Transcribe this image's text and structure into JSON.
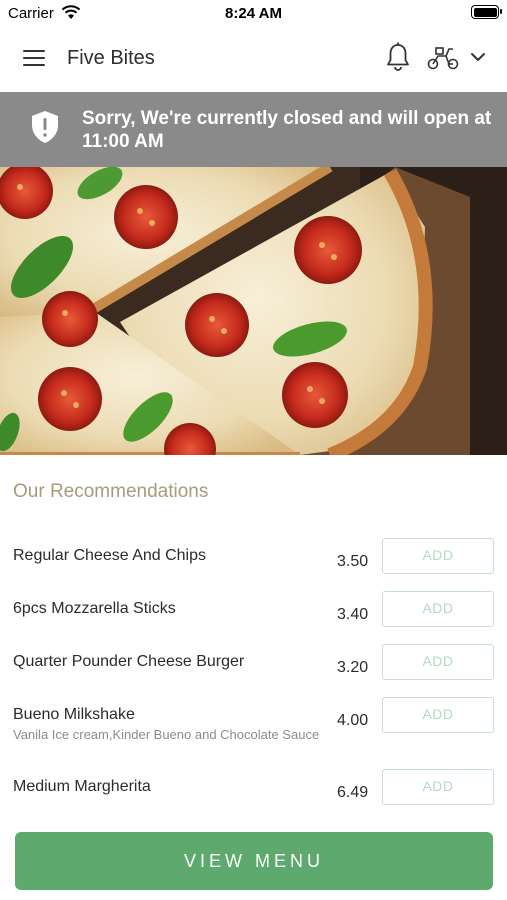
{
  "status_bar": {
    "carrier": "Carrier",
    "time": "8:24 AM"
  },
  "header": {
    "title": "Five Bites",
    "menu_icon": "hamburger-menu-icon",
    "notification_icon": "bell-icon",
    "delivery_icon": "scooter-icon",
    "dropdown_icon": "chevron-down-icon"
  },
  "banner": {
    "message": "Sorry, We're currently closed and will open at 11:00 AM",
    "icon": "shield-alert-icon",
    "background_color": "#8a8a8a"
  },
  "hero": {
    "image_subject": "pizza-slices"
  },
  "recommendations": {
    "title": "Our Recommendations",
    "add_label": "ADD",
    "items": [
      {
        "name": "Regular Cheese And Chips",
        "description": "",
        "price": "3.50"
      },
      {
        "name": "6pcs Mozzarella Sticks",
        "description": "",
        "price": "3.40"
      },
      {
        "name": "Quarter Pounder Cheese Burger",
        "description": "",
        "price": "3.20"
      },
      {
        "name": "Bueno Milkshake",
        "description": "Vanila Ice cream,Kinder Bueno and Chocolate Sauce",
        "price": "4.00"
      },
      {
        "name": "Medium Margherita",
        "description": "",
        "price": "6.49"
      }
    ]
  },
  "footer": {
    "view_menu_label": "VIEW MENU",
    "accent_color": "#5eaa6e"
  }
}
